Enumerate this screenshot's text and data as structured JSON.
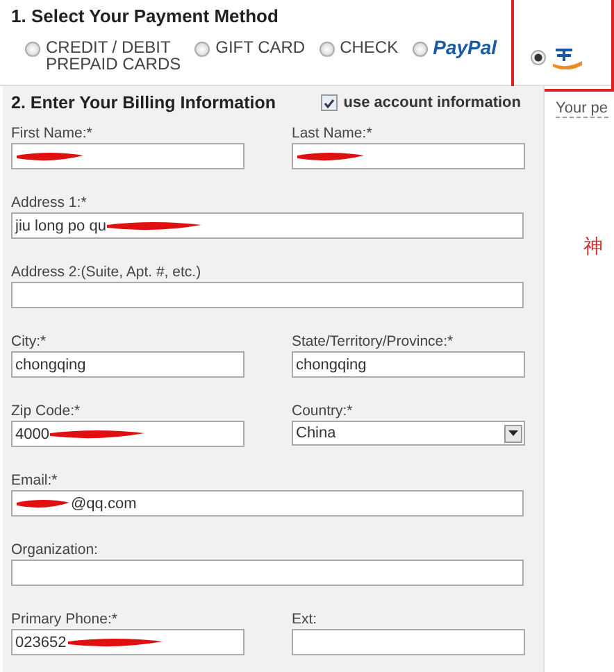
{
  "payment": {
    "title": "1. Select Your Payment Method",
    "options": [
      {
        "kind": "text",
        "label": "CREDIT / DEBIT\nPREPAID CARDS",
        "selected": false,
        "highlighted": false
      },
      {
        "kind": "text",
        "label": "GIFT CARD",
        "selected": false,
        "highlighted": false
      },
      {
        "kind": "text",
        "label": "CHECK",
        "selected": false,
        "highlighted": false
      },
      {
        "kind": "paypal",
        "label": "PayPal",
        "selected": false,
        "highlighted": false
      },
      {
        "kind": "alipay",
        "selected": true,
        "highlighted": true
      }
    ]
  },
  "billing": {
    "title": "2. Enter Your Billing Information",
    "use_account": {
      "label": "use account information",
      "checked": true
    },
    "rows": [
      [
        {
          "label": "First Name:*",
          "redacted": true,
          "mark_first": false,
          "kind": "input"
        },
        {
          "label": "Last Name:*",
          "redacted": true,
          "mark_first": false,
          "kind": "input"
        }
      ],
      [
        {
          "label": "Address 1:*",
          "value": "jiu long po qu",
          "redacted": true,
          "mark_first": false,
          "kind": "input"
        }
      ],
      [
        {
          "label": "Address 2:(Suite, Apt. #, etc.)",
          "redacted": false,
          "kind": "input"
        }
      ],
      [
        {
          "label": "City:*",
          "value": "chongqing",
          "redacted": false,
          "kind": "input"
        },
        {
          "label": "State/Territory/Province:*",
          "value": "chongqing",
          "redacted": false,
          "kind": "input"
        }
      ],
      [
        {
          "label": "Zip Code:*",
          "value": "4000",
          "redacted": true,
          "mark_first": false,
          "kind": "input"
        },
        {
          "label": "Country:*",
          "value": "China",
          "kind": "select"
        }
      ],
      [
        {
          "label": "Email:*",
          "value": "@qq.com",
          "redacted": true,
          "mark_first": true,
          "kind": "input"
        }
      ],
      [
        {
          "label": "Organization:",
          "redacted": false,
          "kind": "input"
        }
      ],
      [
        {
          "label": "Primary Phone:*",
          "value": "023652",
          "redacted": true,
          "mark_first": false,
          "kind": "input"
        },
        {
          "label": "Ext:",
          "redacted": false,
          "kind": "input"
        }
      ]
    ]
  },
  "side": {
    "text": "Your pe",
    "note": "神"
  }
}
